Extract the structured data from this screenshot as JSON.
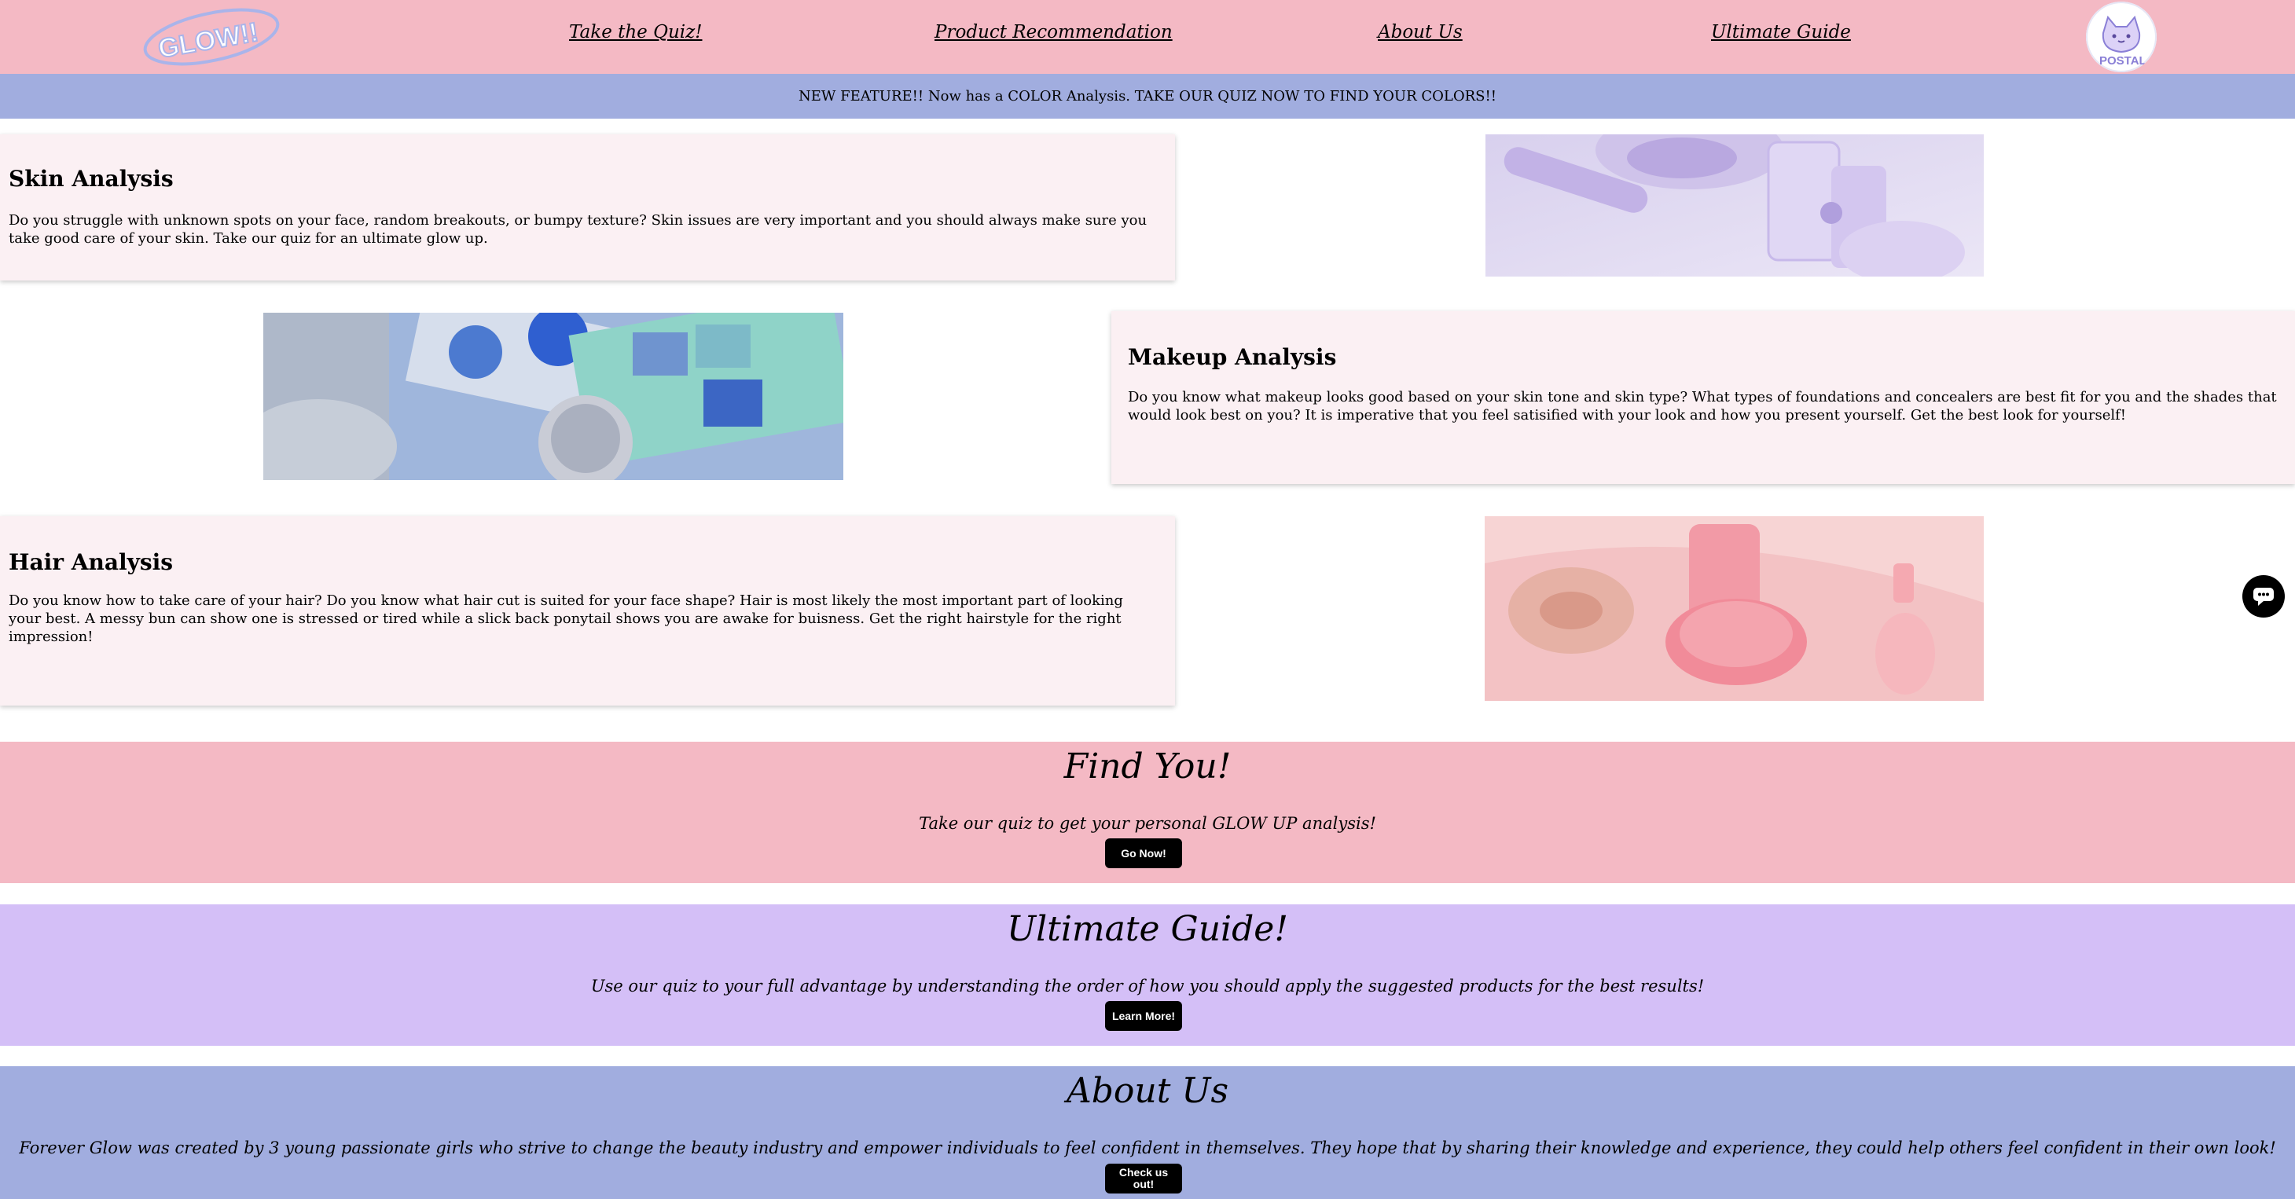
{
  "nav": {
    "logo_text": "GLOW!!",
    "links": [
      {
        "label": "Take the Quiz!"
      },
      {
        "label": "Product Recommendation"
      },
      {
        "label": "About Us"
      },
      {
        "label": "Ultimate Guide"
      }
    ],
    "avatar_text": "POSTAL"
  },
  "banner": {
    "text": "NEW FEATURE!! Now has a COLOR Analysis. TAKE OUR QUIZ NOW TO FIND YOUR COLORS!!"
  },
  "analyses": [
    {
      "title": "Skin Analysis",
      "body": "Do you struggle with unknown spots on your face, random breakouts, or bumpy texture? Skin issues are very important and you should always make sure you take good care of your skin. Take our quiz for an ultimate glow up."
    },
    {
      "title": "Makeup Analysis",
      "body": "Do you know what makeup looks good based on your skin tone and skin type? What types of foundations and concealers are best fit for you and the shades that would look best on you? It is imperative that you feel satisified with your look and how you present yourself. Get the best look for yourself!"
    },
    {
      "title": "Hair Analysis",
      "body": "Do you know how to take care of your hair? Do you know what hair cut is suited for your face shape? Hair is most likely the most important part of looking your best. A messy bun can show one is stressed or tired while a slick back ponytail shows you are awake for buisness. Get the right hairstyle for the right impression!"
    }
  ],
  "sections": [
    {
      "title": "Find You!",
      "text": "Take our quiz to get your personal GLOW UP analysis!",
      "button": "Go Now!",
      "color": "#f4b9c4"
    },
    {
      "title": "Ultimate Guide!",
      "text": "Use our quiz to your full advantage by understanding the order of how you should apply the suggested products for the best results!",
      "button": "Learn More!",
      "color": "#d4bff7"
    },
    {
      "title": "About Us",
      "text": "Forever Glow was created by 3 young passionate girls who strive to change the beauty industry and empower individuals to feel confident in themselves. They hope that by sharing their knowledge and experience, they could help others feel confident in their own look!",
      "button": "Check us out!",
      "color": "#a1addf"
    }
  ],
  "colors": {
    "nav_bg": "#f4b9c4",
    "banner_bg": "#a1addf",
    "card_bg": "#fbf0f3"
  },
  "icons": [
    "logo-icon",
    "avatar-icon",
    "chat-icon"
  ]
}
